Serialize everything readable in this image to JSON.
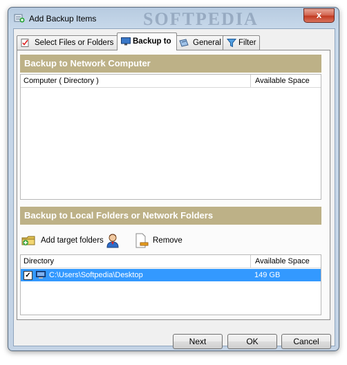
{
  "window": {
    "title": "Add Backup Items",
    "watermark": "SOFTPEDIA",
    "close_glyph": "x"
  },
  "tabs": [
    {
      "label": "Select Files or Folders",
      "icon": "checklist-icon"
    },
    {
      "label": "Backup to",
      "icon": "monitor-icon",
      "active": true
    },
    {
      "label": "General",
      "icon": "general-icon"
    },
    {
      "label": "Filter",
      "icon": "filter-icon"
    }
  ],
  "network_section": {
    "header": "Backup to Network Computer",
    "columns": [
      "Computer ( Directory )",
      "Available Space"
    ]
  },
  "local_section": {
    "header": "Backup to Local Folders or Network Folders",
    "toolbar": {
      "add_label": "Add target folders",
      "remove_label": "Remove"
    },
    "columns": [
      "Directory",
      "Available Space"
    ],
    "rows": [
      {
        "checked": true,
        "check_glyph": "✓",
        "path": "C:\\Users\\Softpedia\\Desktop",
        "space": "149 GB"
      }
    ]
  },
  "buttons": {
    "next": "Next",
    "ok": "OK",
    "cancel": "Cancel"
  },
  "colors": {
    "section_header": "#bdb187",
    "selection": "#3399ff"
  }
}
